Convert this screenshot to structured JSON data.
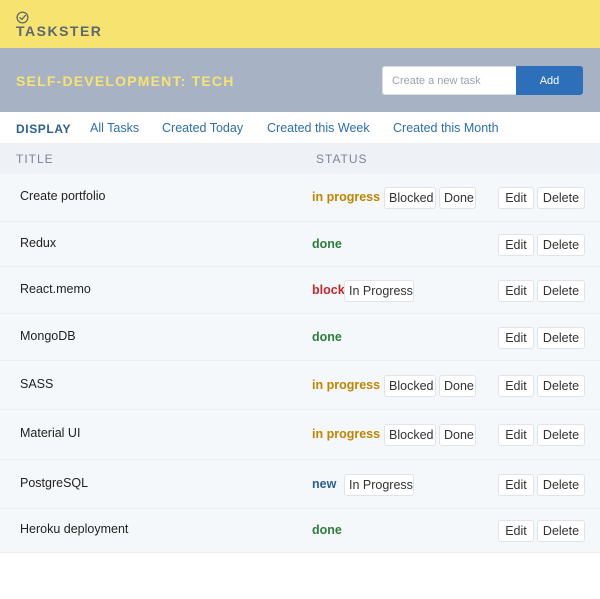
{
  "app": {
    "name": "TASKSTER",
    "logo_icon": "check-circle-icon"
  },
  "project": {
    "title": "SELF-DEVELOPMENT: TECH",
    "new_task_placeholder": "Create a new task",
    "add_label": "Add"
  },
  "filters": {
    "label": "DISPLAY",
    "items": [
      "All Tasks",
      "Created Today",
      "Created this Week",
      "Created this Month"
    ]
  },
  "table": {
    "columns": [
      "TITLE",
      "STATUS"
    ],
    "edit_label": "Edit",
    "delete_label": "Delete",
    "rows": [
      {
        "title": "Create portfolio",
        "status": "in progress",
        "actions": [
          "Blocked",
          "Done"
        ]
      },
      {
        "title": "Redux",
        "status": "done",
        "actions": []
      },
      {
        "title": "React.memo",
        "status": "blocked",
        "actions": [
          "In Progress"
        ]
      },
      {
        "title": "MongoDB",
        "status": "done",
        "actions": []
      },
      {
        "title": "SASS",
        "status": "in progress",
        "actions": [
          "Blocked",
          "Done"
        ]
      },
      {
        "title": "Material UI",
        "status": "in progress",
        "actions": [
          "Blocked",
          "Done"
        ]
      },
      {
        "title": "PostgreSQL",
        "status": "new",
        "actions": [
          "In Progress"
        ]
      },
      {
        "title": "Heroku deployment",
        "status": "done",
        "actions": []
      }
    ]
  },
  "colors": {
    "header_yellow": "#f7e36f",
    "project_bar": "#a7b3c4",
    "accent_blue": "#2d6fb8",
    "status_in_progress": "#c08400",
    "status_done": "#2f7d3c",
    "status_blocked": "#c1272d",
    "status_new": "#2d5f92"
  }
}
